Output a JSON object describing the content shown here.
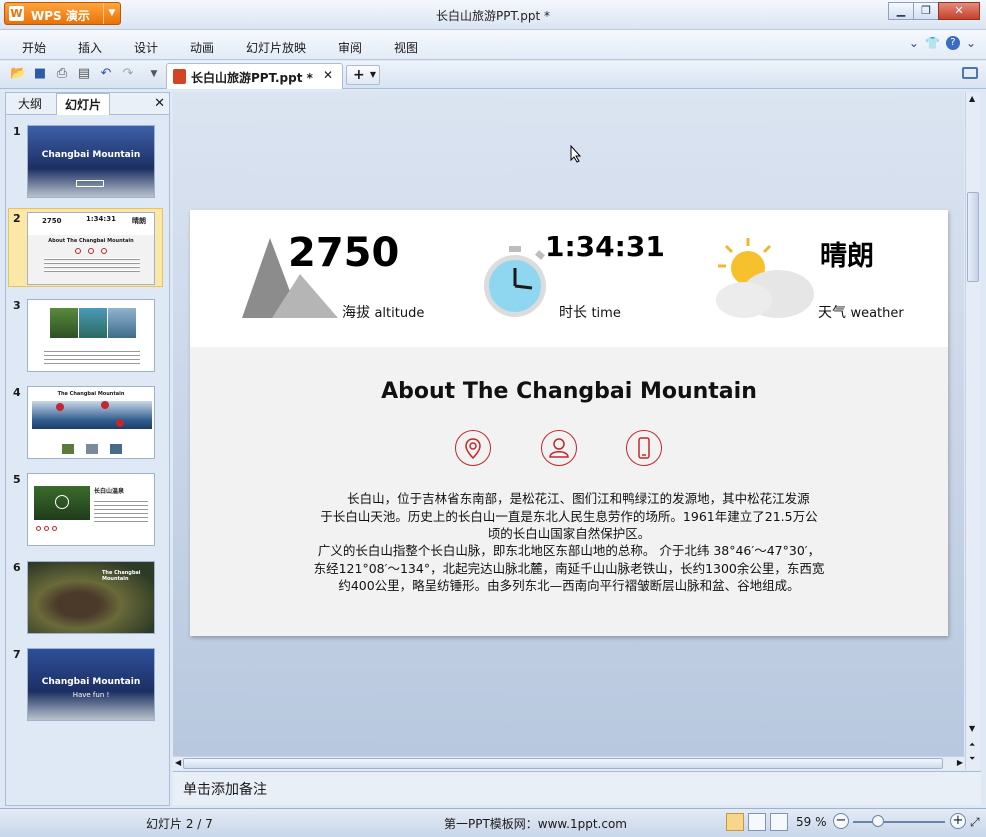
{
  "app": {
    "menu_button": "WPS 演示",
    "document_title": "长白山旅游PPT.ppt *"
  },
  "menu": [
    "开始",
    "插入",
    "设计",
    "动画",
    "幻灯片放映",
    "审阅",
    "视图"
  ],
  "tab": {
    "filename": "长白山旅游PPT.ppt",
    "modified_marker": "*",
    "close": "✕",
    "new": "+"
  },
  "left_panel": {
    "tabs": [
      "大纲",
      "幻灯片"
    ],
    "active_tab": "幻灯片",
    "thumbnails": [
      {
        "num": "1",
        "caption": "Changbai Mountain"
      },
      {
        "num": "2",
        "caption": "About The Changbai Mountain"
      },
      {
        "num": "3",
        "caption": ""
      },
      {
        "num": "4",
        "caption": "The Changbai Mountain"
      },
      {
        "num": "5",
        "caption": "长白山温泉"
      },
      {
        "num": "6",
        "caption": "The Changbai Mountain"
      },
      {
        "num": "7",
        "caption": "Changbai Mountain",
        "sub": "Have fun !"
      }
    ]
  },
  "slide": {
    "stats": [
      {
        "value": "2750",
        "label_cn": "海拔",
        "label_en": "altitude"
      },
      {
        "value": "1:34:31",
        "label_cn": "时长",
        "label_en": "time"
      },
      {
        "value": "晴朗",
        "label_cn": "天气",
        "label_en": "weather"
      }
    ],
    "about_title": "About The Changbai Mountain",
    "paragraph_1_lines": [
      "长白山，位于吉林省东南部，是松花江、图们江和鸭绿江的发源地，其中松花江发源",
      "于长白山天池。历史上的长白山一直是东北人民生息劳作的场所。1961年建立了21.5万公",
      "顷的长白山国家自然保护区。"
    ],
    "paragraph_2_lines": [
      "广义的长白山指整个长白山脉，即东北地区东部山地的总称。 介于北纬 38°46′～47°30′，",
      "东经121°08′～134°，北起完达山脉北麓，南延千山山脉老铁山，长约1300余公里，东西宽",
      "约400公里，略呈纺锤形。由多列东北—西南向平行褶皱断层山脉和盆、谷地组成。"
    ]
  },
  "notes": {
    "placeholder": "单击添加备注"
  },
  "status": {
    "slide_counter": "幻灯片 2 / 7",
    "template_site": "第一PPT模板网：www.1ppt.com",
    "zoom": "59 %"
  },
  "colors": {
    "accent_red": "#c0282e",
    "title_orange": "#e8720a",
    "selected_thumb": "#fbe7a6"
  }
}
